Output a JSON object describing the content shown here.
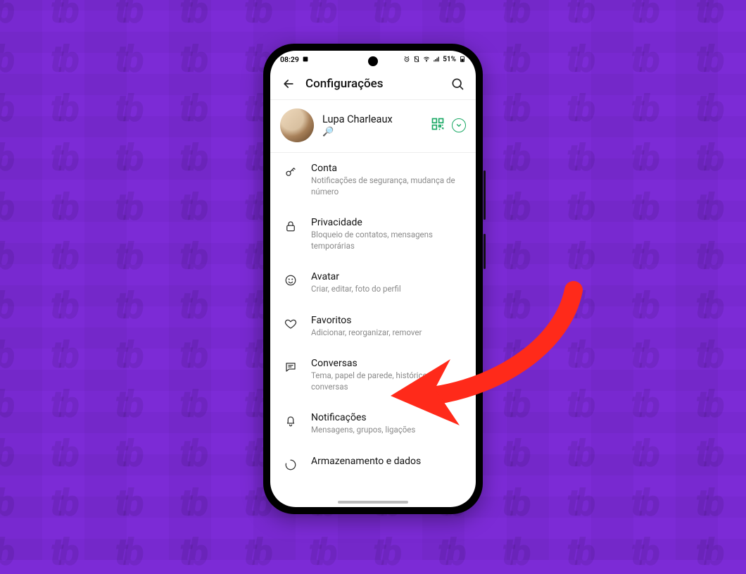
{
  "statusbar": {
    "time": "08:29",
    "battery": "51%"
  },
  "header": {
    "title": "Configurações"
  },
  "profile": {
    "name": "Lupa Charleaux",
    "status": "🔎"
  },
  "settings": [
    {
      "id": "account",
      "icon": "key",
      "title": "Conta",
      "subtitle": "Notificações de segurança, mudança de número"
    },
    {
      "id": "privacy",
      "icon": "lock",
      "title": "Privacidade",
      "subtitle": "Bloqueio de contatos, mensagens temporárias"
    },
    {
      "id": "avatar",
      "icon": "face",
      "title": "Avatar",
      "subtitle": "Criar, editar, foto do perfil"
    },
    {
      "id": "favorites",
      "icon": "heart",
      "title": "Favoritos",
      "subtitle": "Adicionar, reorganizar, remover"
    },
    {
      "id": "chats",
      "icon": "chat",
      "title": "Conversas",
      "subtitle": "Tema, papel de parede, histórico de conversas"
    },
    {
      "id": "notifs",
      "icon": "bell",
      "title": "Notificações",
      "subtitle": "Mensagens, grupos, ligações"
    },
    {
      "id": "storage",
      "icon": "circle",
      "title": "Armazenamento e dados",
      "subtitle": ""
    }
  ],
  "colors": {
    "accent": "#19a864",
    "arrow": "#ff2a1a"
  }
}
